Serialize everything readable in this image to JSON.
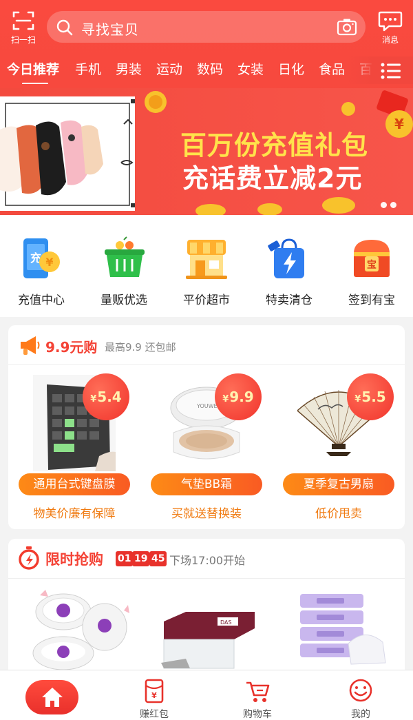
{
  "header": {
    "scan_label": "扫一扫",
    "search_placeholder": "寻找宝贝",
    "messages_label": "消息"
  },
  "tabs": [
    "今日推荐",
    "手机",
    "男装",
    "运动",
    "数码",
    "女装",
    "日化",
    "食品",
    "百"
  ],
  "banner": {
    "line1": "百万份充值礼包",
    "line2": "充话费立减2元"
  },
  "quick_nav": [
    {
      "label": "充值中心",
      "icon": "phone-recharge-icon"
    },
    {
      "label": "量贩优选",
      "icon": "shopping-basket-icon"
    },
    {
      "label": "平价超市",
      "icon": "store-icon"
    },
    {
      "label": "特卖清仓",
      "icon": "lightning-bag-icon"
    },
    {
      "label": "签到有宝",
      "icon": "treasure-chest-icon"
    }
  ],
  "deal99": {
    "title": "9.9元购",
    "subtitle": "最高9.9 还包邮",
    "products": [
      {
        "name": "通用台式键盘膜",
        "price": "5.4",
        "currency": "¥",
        "tag": "物美价廉有保障"
      },
      {
        "name": "气垫BB霜",
        "price": "9.9",
        "currency": "¥",
        "tag": "买就送替换装"
      },
      {
        "name": "夏季复古男扇",
        "price": "5.5",
        "currency": "¥",
        "tag": "低价甩卖"
      }
    ]
  },
  "flash_sale": {
    "title": "限时抢购",
    "countdown": [
      "01",
      "19",
      "45"
    ],
    "next": "下场17:00开始"
  },
  "tabbar": {
    "earn_label": "赚红包",
    "cart_label": "购物车",
    "me_label": "我的"
  },
  "colors": {
    "brand_red": "#f2473d",
    "price_orange": "#f07a10",
    "banner_yellow": "#ffe34b"
  }
}
